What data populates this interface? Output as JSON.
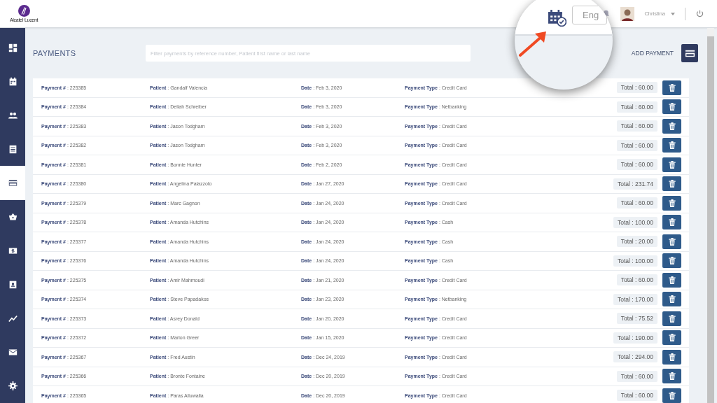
{
  "header": {
    "logo_text": "Alcatel·Lucent",
    "user_name": "Christina"
  },
  "magnifier": {
    "language_field": "Eng"
  },
  "sidebar": {
    "items": [
      {
        "kind": "dashboard",
        "selected": false
      },
      {
        "kind": "calendar",
        "selected": false
      },
      {
        "kind": "people",
        "selected": false
      },
      {
        "kind": "list",
        "selected": false
      },
      {
        "kind": "card",
        "selected": true
      },
      {
        "kind": "basket",
        "selected": false
      },
      {
        "kind": "dollar",
        "selected": false
      },
      {
        "kind": "contact",
        "selected": false
      },
      {
        "kind": "chart",
        "selected": false
      },
      {
        "kind": "mail",
        "selected": false
      },
      {
        "kind": "gear",
        "selected": false
      }
    ]
  },
  "page": {
    "title": "PAYMENTS",
    "search": {
      "placeholder": "Filter payments by reference number, Patient first name or last name"
    },
    "add_button": "ADD PAYMENT"
  },
  "payments": [
    {
      "payment": "**Payment #** : 225385",
      "patient": "**Patient** : Gandalf Valencia",
      "date": "**Date** : Feb 3, 2020",
      "type": "**Payment Type** : Credit Card",
      "total": "Total : 60.00"
    },
    {
      "payment": "**Payment #** : 225384",
      "patient": "**Patient** : Deliah Schreiber",
      "date": "**Date** : Feb 3, 2020",
      "type": "**Payment Type** : Netbanking",
      "total": "Total : 60.00"
    },
    {
      "payment": "**Payment #** : 225383",
      "patient": "**Patient** : Jason Todgham",
      "date": "**Date** : Feb 3, 2020",
      "type": "**Payment Type** : Credit Card",
      "total": "Total : 60.00"
    },
    {
      "payment": "**Payment #** : 225382",
      "patient": "**Patient** : Jason Todgham",
      "date": "**Date** : Feb 3, 2020",
      "type": "**Payment Type** : Credit Card",
      "total": "Total : 60.00"
    },
    {
      "payment": "**Payment #** : 225381",
      "patient": "**Patient** : Bonnie Hunter",
      "date": "**Date** : Feb 2, 2020",
      "type": "**Payment Type** : Credit Card",
      "total": "Total : 60.00"
    },
    {
      "payment": "**Payment #** : 225380",
      "patient": "**Patient** : Angelina Palazzolo",
      "date": "**Date** : Jan 27, 2020",
      "type": "**Payment Type** : Credit Card",
      "total": "Total : 231.74"
    },
    {
      "payment": "**Payment #** : 225379",
      "patient": "**Patient** : Marc Gagnon",
      "date": "**Date** : Jan 24, 2020",
      "type": "**Payment Type** : Credit Card",
      "total": "Total : 60.00"
    },
    {
      "payment": "**Payment #** : 225378",
      "patient": "**Patient** : Amanda Hutchins",
      "date": "**Date** : Jan 24, 2020",
      "type": "**Payment Type** : Cash",
      "total": "Total : 100.00"
    },
    {
      "payment": "**Payment #** : 225377",
      "patient": "**Patient** : Amanda Hutchins",
      "date": "**Date** : Jan 24, 2020",
      "type": "**Payment Type** : Cash",
      "total": "Total : 20.00"
    },
    {
      "payment": "**Payment #** : 225376",
      "patient": "**Patient** : Amanda Hutchins",
      "date": "**Date** : Jan 24, 2020",
      "type": "**Payment Type** : Cash",
      "total": "Total : 100.00"
    },
    {
      "payment": "**Payment #** : 225375",
      "patient": "**Patient** : Amir Mahmoudi",
      "date": "**Date** : Jan 21, 2020",
      "type": "**Payment Type** : Credit Card",
      "total": "Total : 60.00"
    },
    {
      "payment": "**Payment #** : 225374",
      "patient": "**Patient** : Steve Papadakos",
      "date": "**Date** : Jan 23, 2020",
      "type": "**Payment Type** : Netbanking",
      "total": "Total : 170.00"
    },
    {
      "payment": "**Payment #** : 225373",
      "patient": "**Patient** : Asrey Donald",
      "date": "**Date** : Jan 20, 2020",
      "type": "**Payment Type** : Credit Card",
      "total": "Total : 75.52"
    },
    {
      "payment": "**Payment #** : 225372",
      "patient": "**Patient** : Marion Greer",
      "date": "**Date** : Jan 15, 2020",
      "type": "**Payment Type** : Credit Card",
      "total": "Total : 190.00"
    },
    {
      "payment": "**Payment #** : 225367",
      "patient": "**Patient** : Fred Austin",
      "date": "**Date** : Dec 24, 2019",
      "type": "**Payment Type** : Credit Card",
      "total": "Total : 294.00"
    },
    {
      "payment": "**Payment #** : 225366",
      "patient": "**Patient** : Bronte Fontaine",
      "date": "**Date** : Dec 20, 2019",
      "type": "**Payment Type** : Credit Card",
      "total": "Total : 60.00"
    },
    {
      "payment": "**Payment #** : 225365",
      "patient": "**Patient** : Paras Alluwalia",
      "date": "**Date** : Dec 20, 2019",
      "type": "**Payment Type** : Credit Card",
      "total": "Total : 60.00"
    }
  ]
}
